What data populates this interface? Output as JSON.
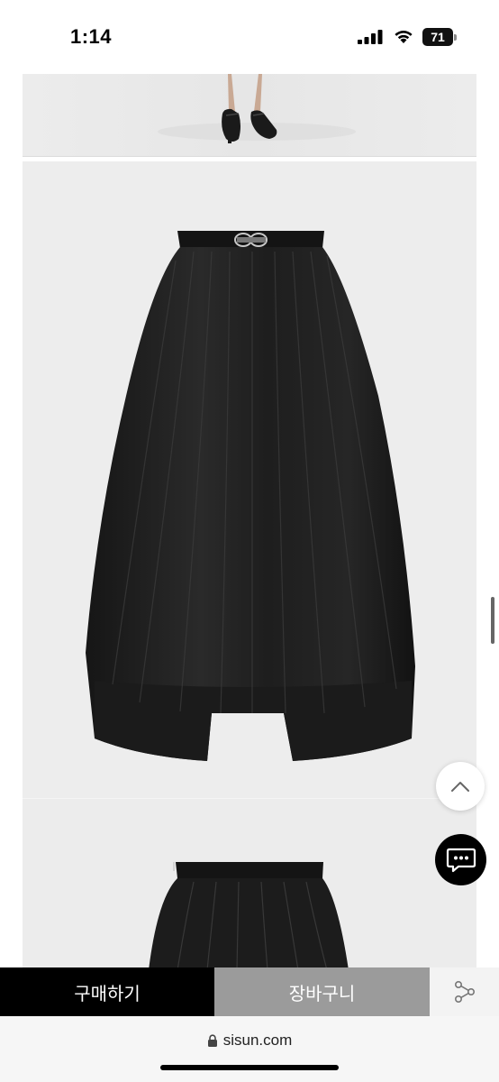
{
  "status_bar": {
    "time": "1:14",
    "battery_level": "71",
    "icons": [
      "signal-icon",
      "wifi-icon",
      "battery-icon"
    ]
  },
  "product_images": [
    {
      "name": "model-shoes-photo"
    },
    {
      "name": "skirt-front-photo"
    },
    {
      "name": "skirt-detail-photo"
    }
  ],
  "floating_buttons": {
    "scroll_top_icon": "chevron-up-icon",
    "chat_icon": "chat-bubble-icon"
  },
  "action_bar": {
    "buy_label": "구매하기",
    "cart_label": "장바구니",
    "share_icon": "share-icon",
    "colors": {
      "buy_bg": "#000000",
      "cart_bg": "#9b9b9b"
    }
  },
  "browser": {
    "url": "sisun.com",
    "lock_icon": "lock-icon"
  }
}
